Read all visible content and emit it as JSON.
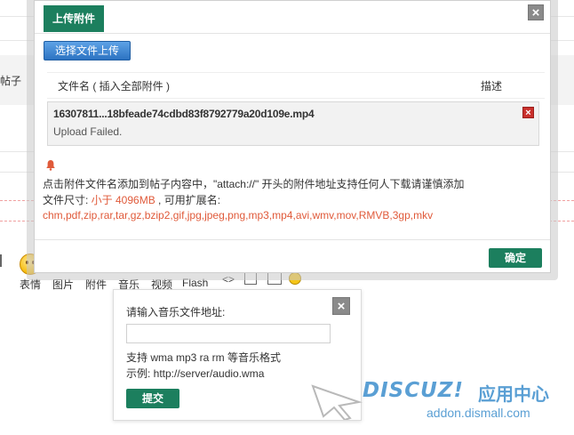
{
  "background": {
    "side_text": "帖子",
    "toolbar": {
      "items": [
        "表情",
        "图片",
        "附件",
        "音乐",
        "视频",
        "Flash"
      ],
      "code_icon_text": "<>"
    }
  },
  "upload_dialog": {
    "title": "上传附件",
    "close_glyph": "×",
    "choose_button": "选择文件上传",
    "columns": {
      "name": "文件名 ( 插入全部附件 )",
      "description": "描述"
    },
    "file": {
      "name": "16307811...18bfeade74cdbd83f8792779a20d109e.mp4",
      "status": "Upload Failed.",
      "delete_glyph": "×"
    },
    "notice_line1": "点击附件文件名添加到帖子内容中，\"attach://\" 开头的附件地址支持任何人下载请谨慎添加",
    "size_label": "文件尺寸: ",
    "size_value": "小于 4096MB",
    "ext_label": " , 可用扩展名:",
    "extensions": "chm,pdf,zip,rar,tar,gz,bzip2,gif,jpg,jpeg,png,mp3,mp4,avi,wmv,mov,RMVB,3gp,mkv",
    "ok_button": "确定"
  },
  "music_popup": {
    "title": "请输入音乐文件地址:",
    "close_glyph": "×",
    "input_value": "",
    "hint_formats": "支持 wma mp3 ra rm 等音乐格式",
    "hint_example": "示例: http://server/audio.wma",
    "submit_button": "提交"
  },
  "watermark": {
    "logo": "DISCUZ!",
    "cn": "应用中心",
    "url": "addon.dismall.com"
  },
  "colors": {
    "accent_green": "#1c7f5e",
    "button_blue": "#2c73c2",
    "notice_red": "#e05a3a",
    "delete_red": "#c9302c",
    "watermark_blue": "#5a9fd4"
  }
}
